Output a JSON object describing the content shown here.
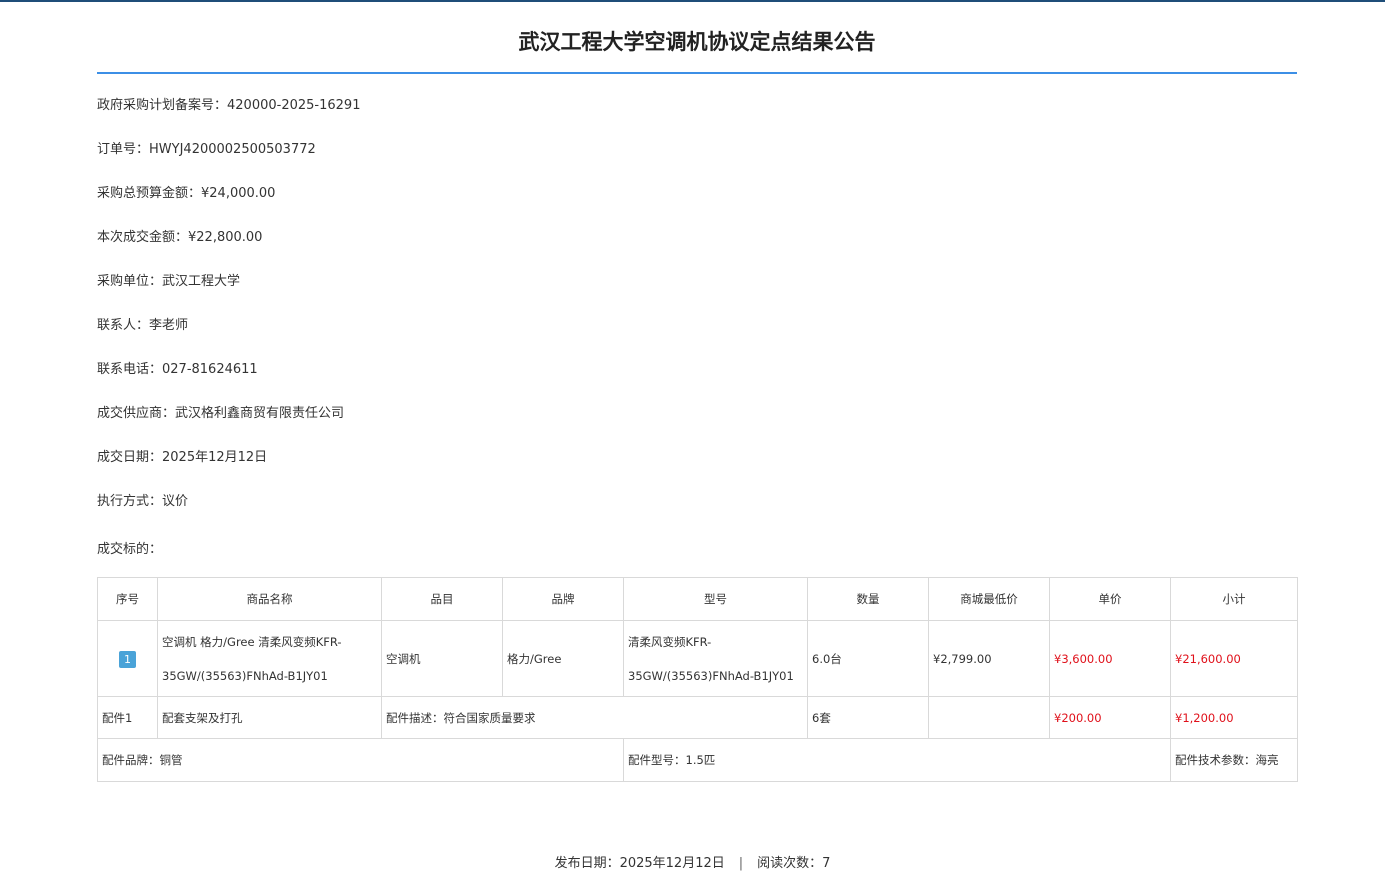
{
  "page": {
    "title": "武汉工程大学空调机协议定点结果公告"
  },
  "info": [
    {
      "key": "政府采购计划备案号：",
      "value": "420000-2025-16291"
    },
    {
      "key": "订单号：",
      "value": "HWYJ4200002500503772"
    },
    {
      "key": "采购总预算金额：",
      "value": "¥24,000.00"
    },
    {
      "key": "本次成交金额：",
      "value": "¥22,800.00"
    },
    {
      "key": "采购单位：",
      "value": "武汉工程大学"
    },
    {
      "key": "联系人：",
      "value": "李老师"
    },
    {
      "key": "联系电话：",
      "value": "027-81624611"
    },
    {
      "key": "成交供应商：",
      "value": "武汉格利鑫商贸有限责任公司"
    },
    {
      "key": "成交日期：",
      "value": "2025年12月12日"
    },
    {
      "key": "执行方式：",
      "value": "议价"
    }
  ],
  "section_label": "成交标的：",
  "table": {
    "headers": [
      "序号",
      "商品名称",
      "品目",
      "品牌",
      "型号",
      "数量",
      "商城最低价",
      "单价",
      "小计"
    ],
    "row": {
      "seq": "1",
      "name": "空调机 格力/Gree 清柔风变频KFR-35GW/(35563)FNhAd-B1JY01",
      "category": "空调机",
      "brand": "格力/Gree",
      "model": "清柔风变频KFR-35GW/(35563)FNhAd-B1JY01",
      "quantity": "6.0台",
      "lowest_price": "¥2,799.00",
      "unit_price": "¥3,600.00",
      "subtotal": "¥21,600.00"
    },
    "accessory": {
      "label": "配件1",
      "name": "配套支架及打孔",
      "desc": "配件描述：符合国家质量要求",
      "quantity": "6套",
      "unit_price": "¥200.00",
      "subtotal": "¥1,200.00",
      "brand": "配件品牌：铜管",
      "model": "配件型号：1.5匹",
      "tech": "配件技术参数：海亮"
    }
  },
  "footer": {
    "publish_date": "发布日期：2025年12月12日",
    "separator": "|",
    "read_count": "阅读次数：7"
  },
  "colors": {
    "title_underline": "#3c8fe6",
    "top_bar": "#1f4e79",
    "price_red": "#e0101a",
    "badge": "#4aa3d8"
  }
}
